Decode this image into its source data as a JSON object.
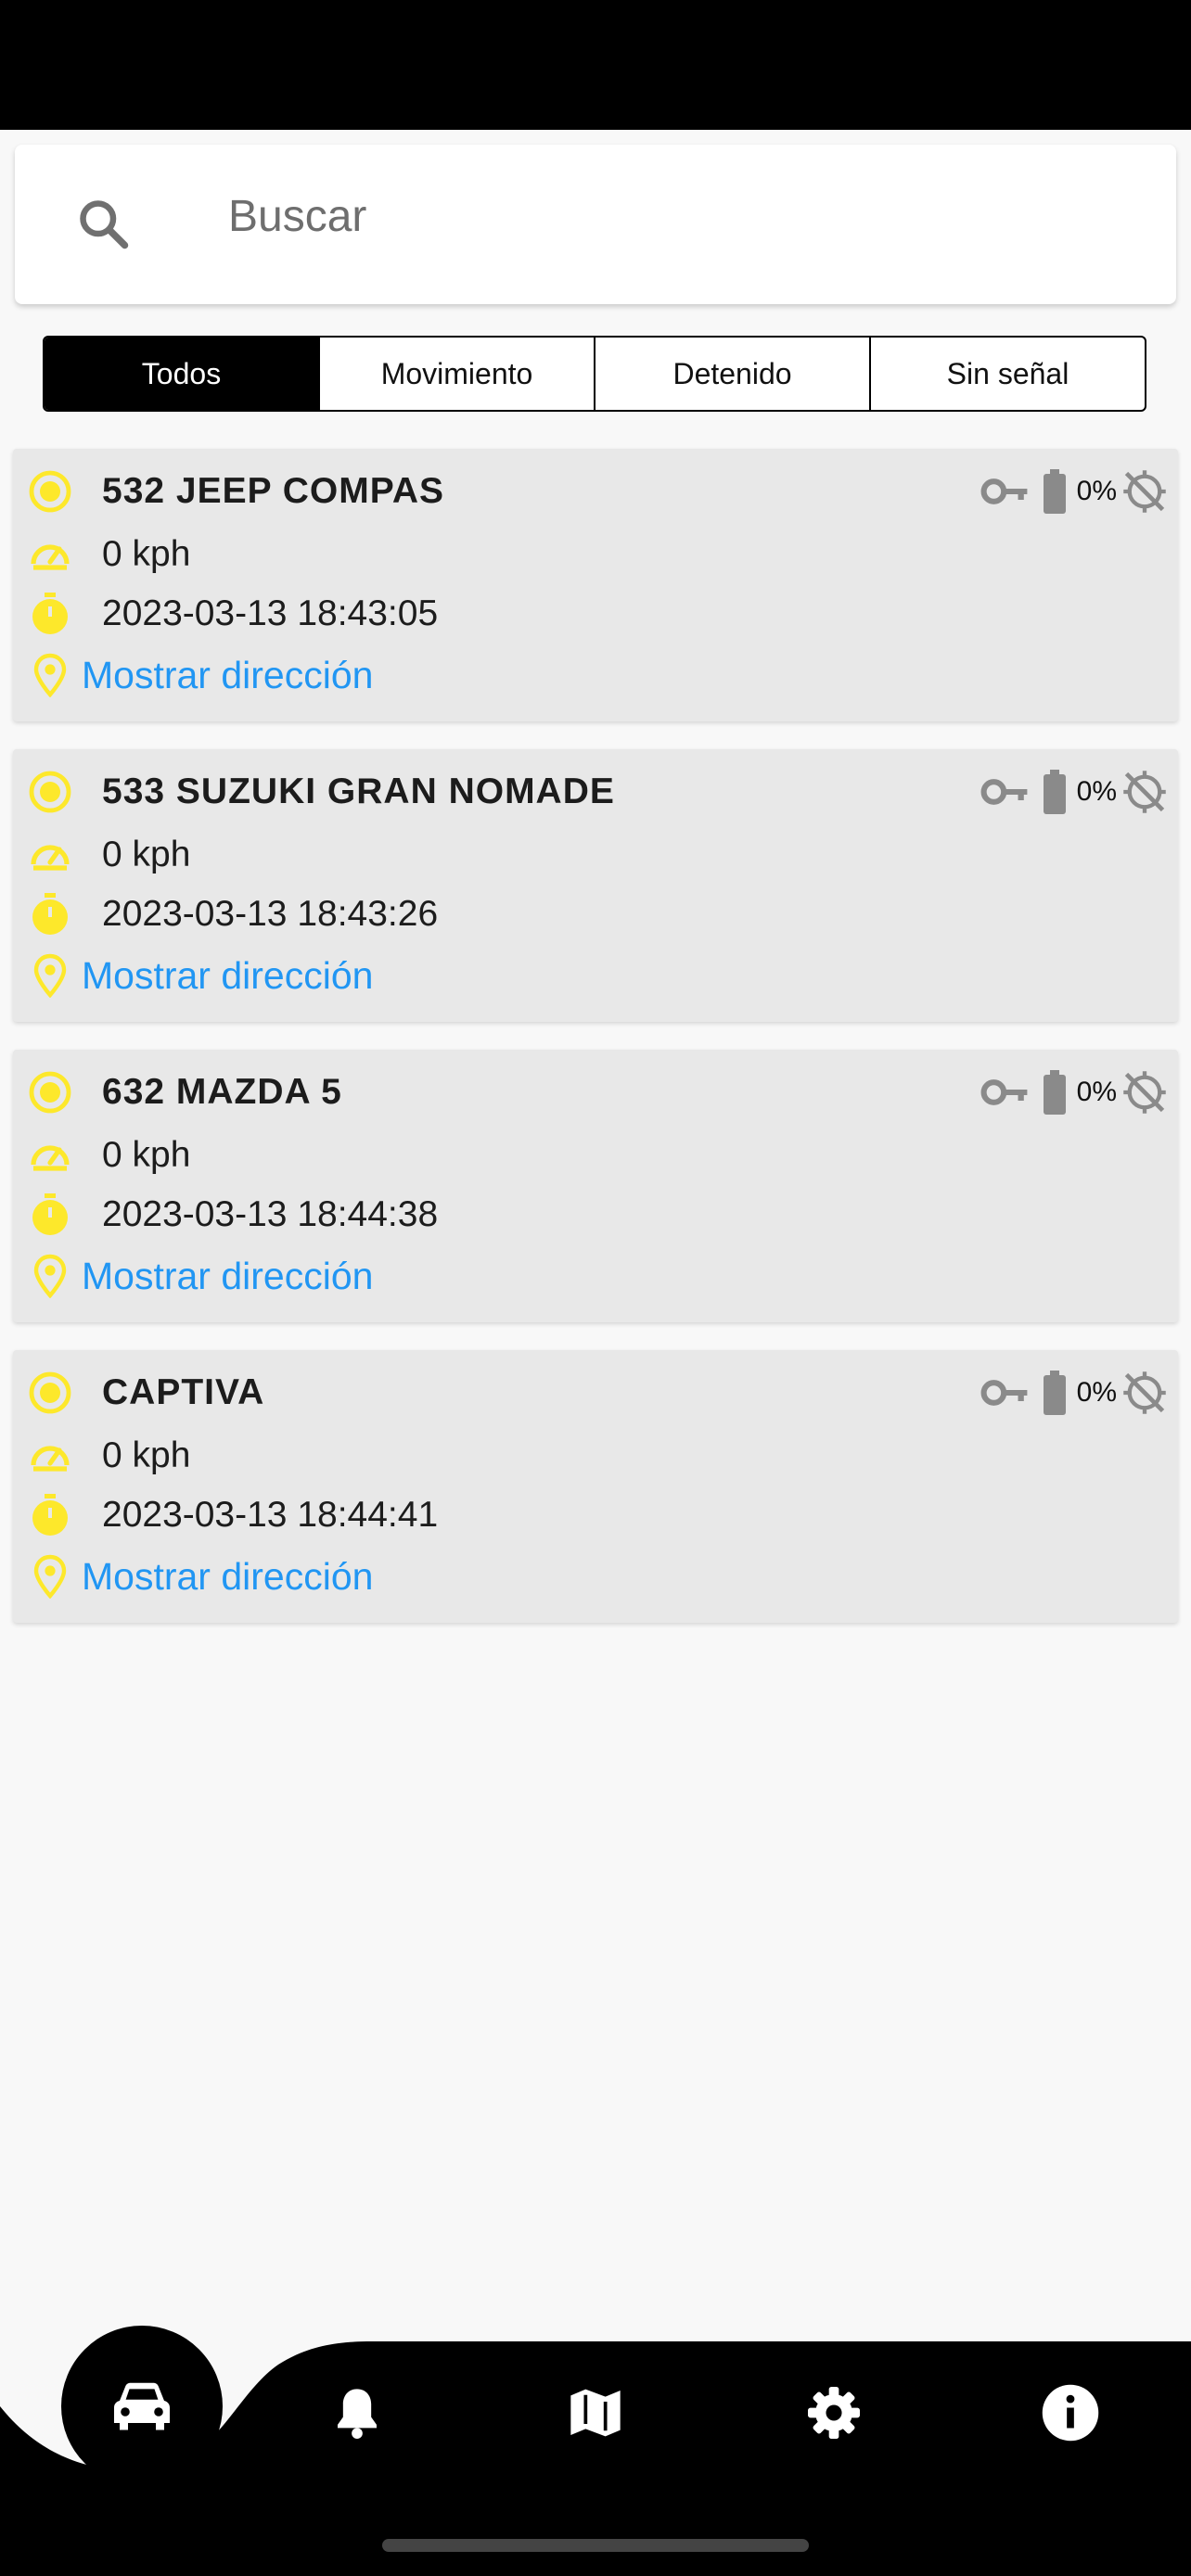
{
  "search": {
    "placeholder": "Buscar"
  },
  "filters": [
    "Todos",
    "Movimiento",
    "Detenido",
    "Sin señal"
  ],
  "selected_filter": "Todos",
  "vehicles": [
    {
      "name": "532 JEEP COMPAS",
      "speed": "0 kph",
      "time": "2023-03-13 18:43:05",
      "battery": "0%",
      "address_link": "Mostrar dirección"
    },
    {
      "name": "533 SUZUKI GRAN NOMADE",
      "speed": "0 kph",
      "time": "2023-03-13 18:43:26",
      "battery": "0%",
      "address_link": "Mostrar dirección"
    },
    {
      "name": "632 MAZDA 5",
      "speed": "0 kph",
      "time": "2023-03-13 18:44:38",
      "battery": "0%",
      "address_link": "Mostrar dirección"
    },
    {
      "name": "CAPTIVA",
      "speed": "0 kph",
      "time": "2023-03-13 18:44:41",
      "battery": "0%",
      "address_link": "Mostrar dirección"
    }
  ],
  "icons": {
    "status": "target-icon",
    "speed": "speedometer-icon",
    "time": "stopwatch-icon",
    "address": "location-pin-icon",
    "ignition": "key-icon",
    "battery": "battery-icon",
    "gps": "gps-off-icon"
  },
  "bottom_nav": [
    "car-icon",
    "bell-icon",
    "map-icon",
    "gear-icon",
    "info-icon"
  ],
  "colors": {
    "accent": "#fde82b",
    "link": "#2196f3",
    "card": "#e8e8e8",
    "selected_tab": "#000000",
    "icon_gray": "#8a8a8a"
  }
}
